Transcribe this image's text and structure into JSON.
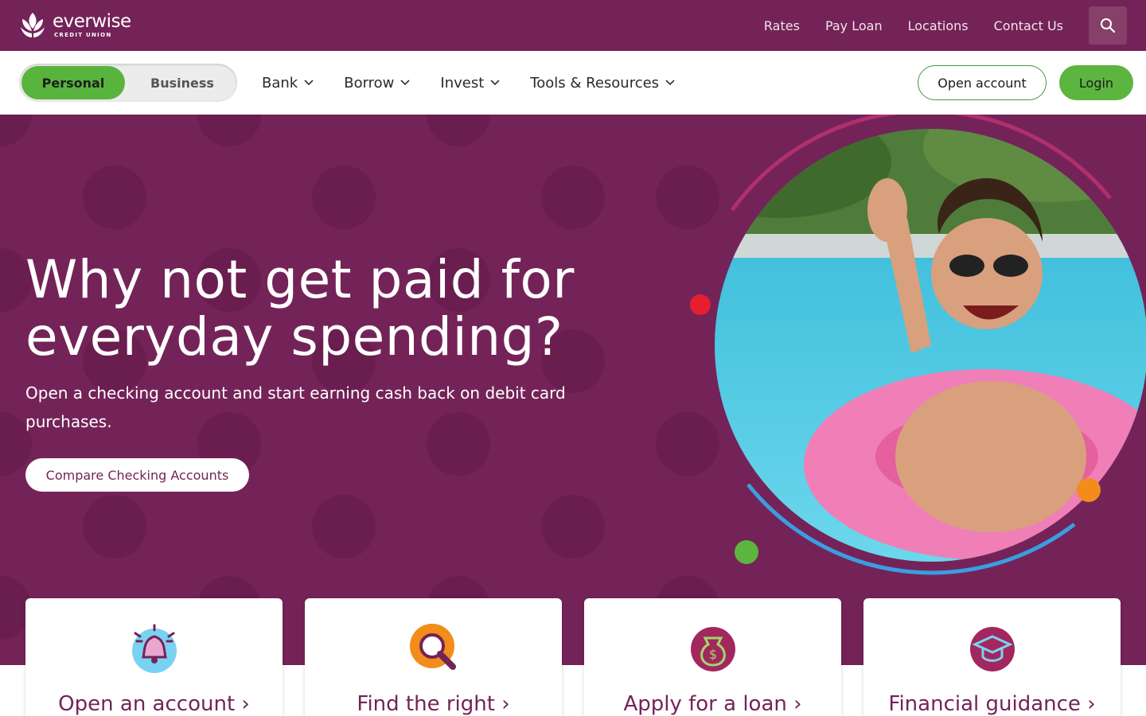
{
  "brand": {
    "name": "everwise",
    "tagline": "CREDIT UNION"
  },
  "utility_nav": [
    "Rates",
    "Pay Loan",
    "Locations",
    "Contact Us"
  ],
  "segment_toggle": {
    "active": "Personal",
    "inactive": "Business"
  },
  "main_menu": [
    "Bank",
    "Borrow",
    "Invest",
    "Tools & Resources"
  ],
  "actions": {
    "open_account": "Open account",
    "login": "Login"
  },
  "hero": {
    "title_line1": "Why not get paid for",
    "title_line2": "everyday spending?",
    "subtitle": "Open a checking account and start earning cash back on debit card purchases.",
    "cta": "Compare Checking Accounts"
  },
  "cards": [
    {
      "title": "Open an account",
      "icon": "bell-icon"
    },
    {
      "title": "Find the right",
      "icon": "magnifier-icon"
    },
    {
      "title": "Apply for a loan",
      "icon": "money-bag-icon"
    },
    {
      "title": "Financial guidance",
      "icon": "graduation-cap-icon"
    }
  ],
  "colors": {
    "brand_purple": "#742358",
    "green": "#59b43d",
    "white": "#ffffff"
  }
}
